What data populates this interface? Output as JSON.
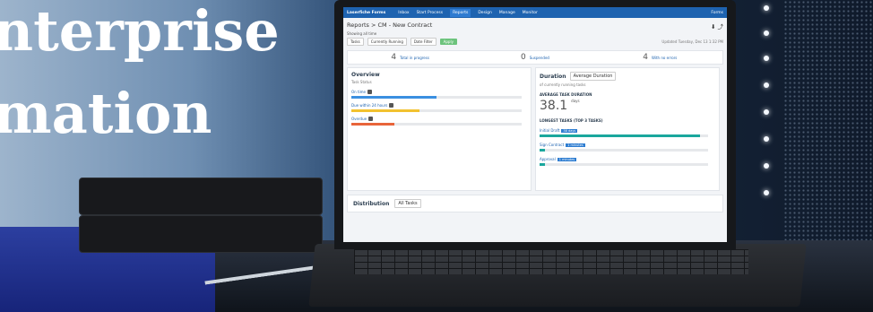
{
  "headline": {
    "line1": "nterprise",
    "line2": "mation"
  },
  "app": {
    "brand": "Laserfiche Forms",
    "nav": [
      "Inbox",
      "Start Process",
      "Reports",
      "Design",
      "Manage",
      "Monitor"
    ],
    "active_nav": "Reports",
    "user": "Forms"
  },
  "report": {
    "breadcrumb": "Reports > CM - New Contract",
    "showing": "Showing all time",
    "filters": {
      "tasks": "Tasks",
      "status": "Currently Running",
      "date": "Date Filter",
      "apply": "Apply"
    },
    "updated": "Updated Tuesday, Dec 13 1:32 PM"
  },
  "stats": [
    {
      "value": "4",
      "label": "Total in progress"
    },
    {
      "value": "0",
      "label": "Suspended"
    },
    {
      "value": "4",
      "label": "With no errors"
    }
  ],
  "overview": {
    "title": "Overview",
    "subtitle": "Task Status",
    "bars": [
      {
        "label": "On time",
        "fraction": 0.5,
        "color": "#3a8fe0"
      },
      {
        "label": "Due within 24 hours",
        "fraction": 0.4,
        "color": "#f2c230"
      },
      {
        "label": "Overdue",
        "fraction": 0.25,
        "color": "#e8643a"
      }
    ]
  },
  "duration": {
    "title": "Duration",
    "select": "Average Duration",
    "subtitle": "of currently running tasks",
    "avg_heading": "AVERAGE TASK DURATION",
    "avg_value": "38.1",
    "avg_unit": "days",
    "longest_heading": "LONGEST TASKS (TOP 3 TASKS)",
    "tasks": [
      {
        "name": "Initial Draft",
        "tag": "38 days",
        "fraction": 0.95
      },
      {
        "name": "Sign Contract",
        "tag": "1 minutes",
        "fraction": 0.03
      },
      {
        "name": "Approval",
        "tag": "1 minutes",
        "fraction": 0.03
      }
    ]
  },
  "distribution": {
    "title": "Distribution",
    "select": "All Tasks"
  }
}
